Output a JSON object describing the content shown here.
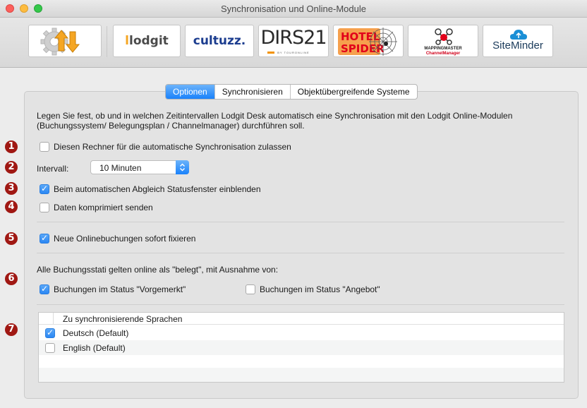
{
  "window": {
    "title": "Synchronisation und Online-Module"
  },
  "toolbar": {
    "items": [
      {
        "name": "sync-settings",
        "icon": "gear-arrows-icon"
      },
      {
        "name": "lodgit",
        "logo_text": "lodgit"
      },
      {
        "name": "cultuzz",
        "logo_text": "cultuzz."
      },
      {
        "name": "dirs21",
        "logo_text": "DIRS21",
        "sub_text": "BY TOURONLINE"
      },
      {
        "name": "hotel-spider",
        "logo_text": "HOTEL SPIDER"
      },
      {
        "name": "mappingmaster",
        "logo_text": "MAPPINGMASTER",
        "sub_text": "ChannelManager"
      },
      {
        "name": "siteminder",
        "logo_text": "SiteMinder"
      }
    ]
  },
  "tabs": [
    "Optionen",
    "Synchronisieren",
    "Objektübergreifende Systeme"
  ],
  "active_tab": 0,
  "description": {
    "line1": "Legen Sie fest, ob und in welchen Zeitintervallen Lodgit Desk automatisch eine Synchronisation mit den Lodgit Online-Modulen",
    "line2": "(Buchungssystem/ Belegungsplan / Channelmanager) durchführen soll."
  },
  "markers": [
    "1",
    "2",
    "3",
    "4",
    "5",
    "6",
    "7"
  ],
  "options": {
    "allow_auto_sync": {
      "label": "Diesen Rechner für die automatische Synchronisation zulassen",
      "checked": false
    },
    "interval": {
      "label": "Intervall:",
      "value": "10 Minuten"
    },
    "show_status_window": {
      "label": "Beim automatischen Abgleich Statusfenster einblenden",
      "checked": true
    },
    "send_compressed": {
      "label": "Daten komprimiert senden",
      "checked": false
    },
    "fix_online_bookings": {
      "label": "Neue Onlinebuchungen sofort fixieren",
      "checked": true
    }
  },
  "booking_status": {
    "intro": "Alle Buchungsstati gelten online als \"belegt\", mit Ausnahme von:",
    "reserved": {
      "label": "Buchungen im Status \"Vorgemerkt\"",
      "checked": true
    },
    "offer": {
      "label": "Buchungen im Status \"Angebot\"",
      "checked": false
    }
  },
  "languages": {
    "header": "Zu synchronisierende Sprachen",
    "items": [
      {
        "label": "Deutsch (Default)",
        "checked": true
      },
      {
        "label": "English (Default)",
        "checked": false
      }
    ]
  }
}
